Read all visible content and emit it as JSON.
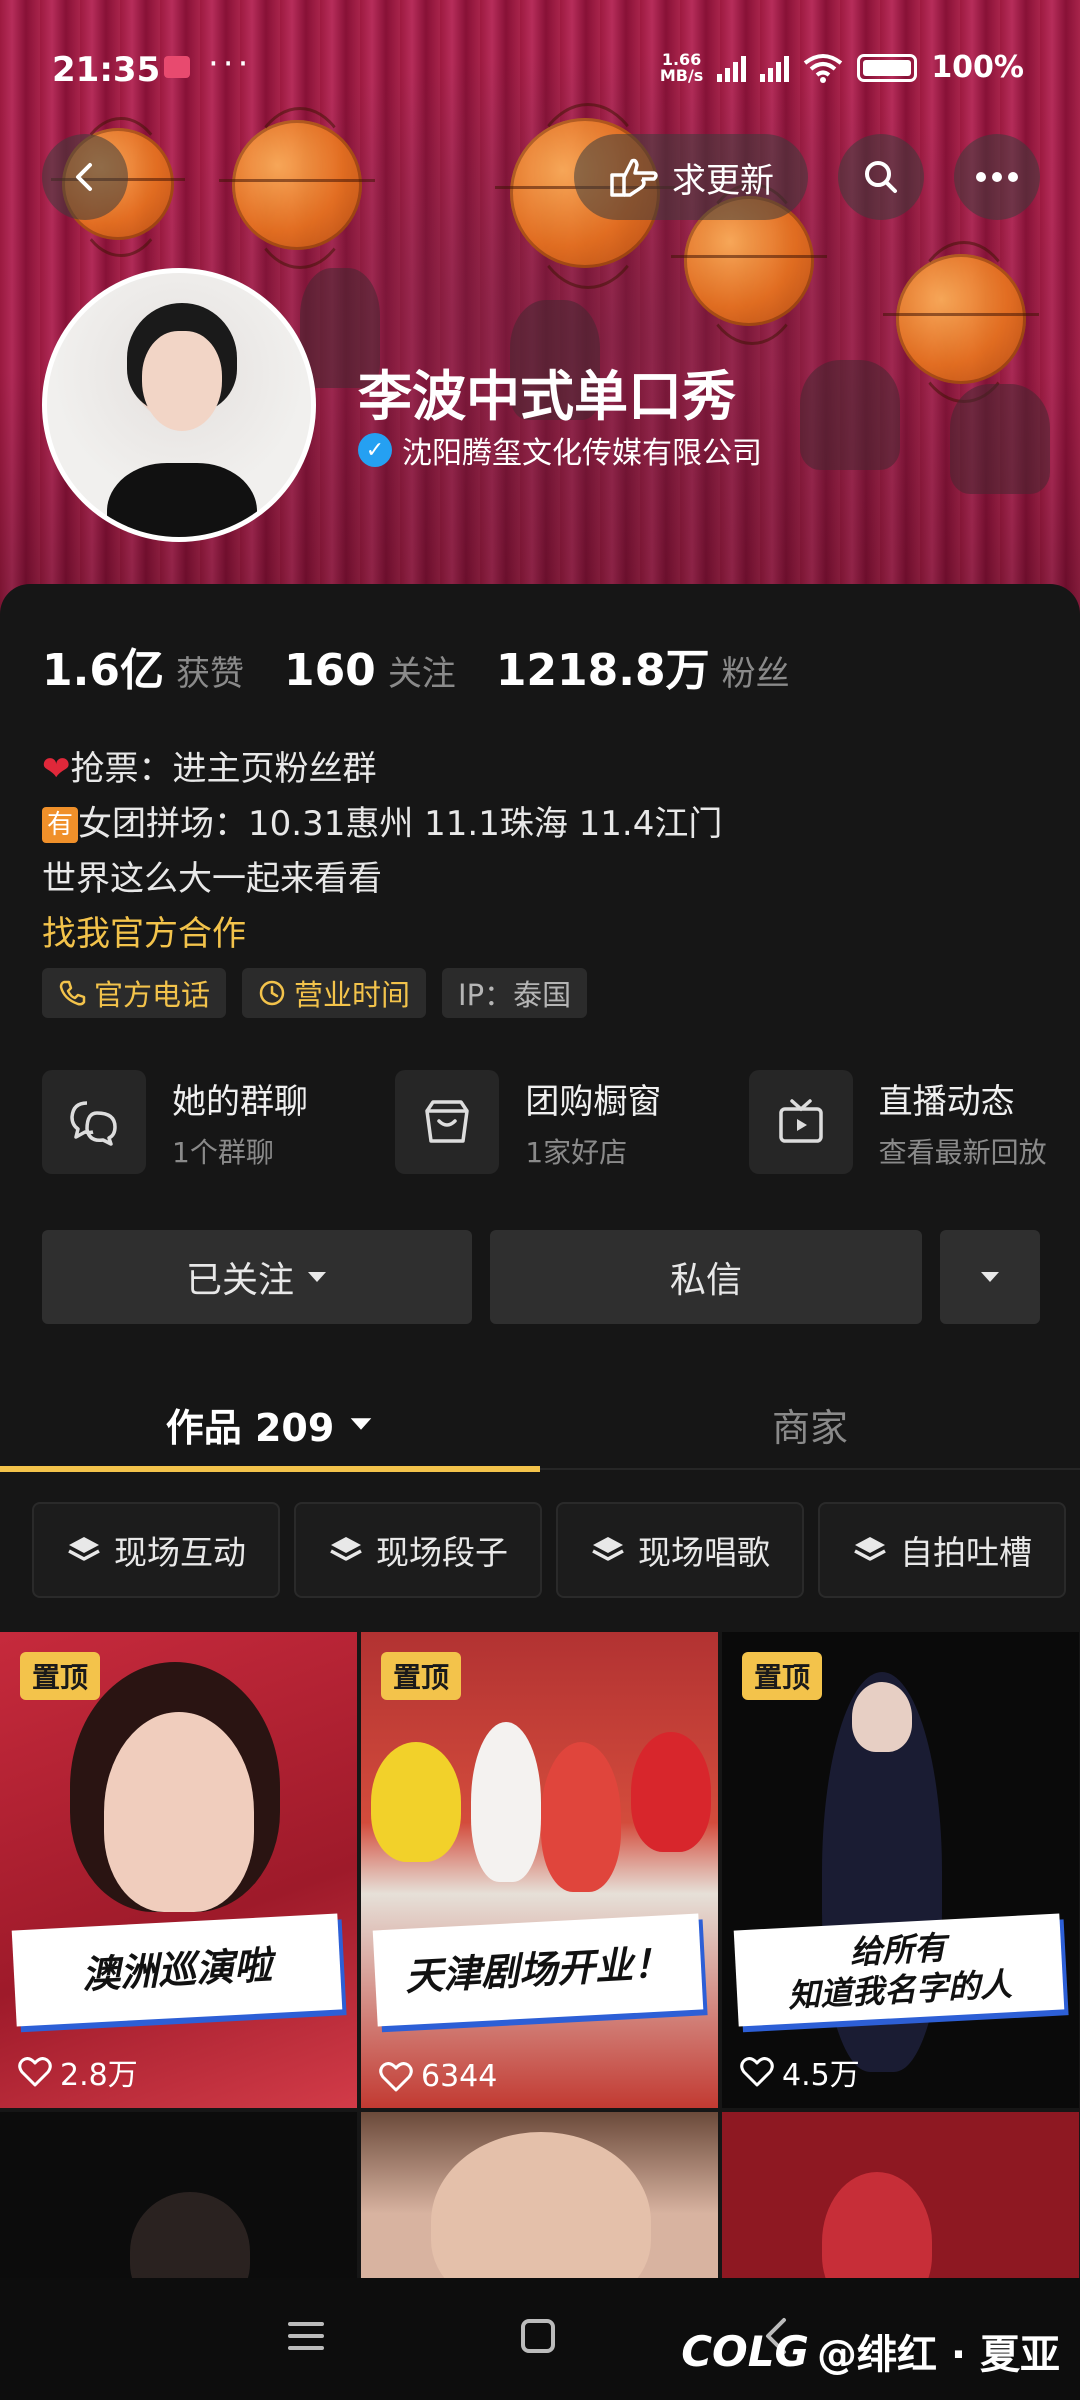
{
  "status_bar": {
    "time": "21:35",
    "more": "···",
    "speed_value": "1.66",
    "speed_unit": "MB/s",
    "battery": "100%"
  },
  "header": {
    "update_label": "求更新"
  },
  "profile": {
    "name": "李波中式单口秀",
    "verified_org": "沈阳腾玺文化传媒有限公司",
    "verify_mark": "✓"
  },
  "stats": [
    {
      "value": "1.6亿",
      "label": "获赞"
    },
    {
      "value": "160",
      "label": "关注"
    },
    {
      "value": "1218.8万",
      "label": "粉丝"
    }
  ],
  "bio": {
    "line1": "抢票：进主页粉丝群",
    "badge": "有",
    "line2": "女团拼场：10.31惠州 11.1珠海 11.4江门",
    "line3": "世界这么大一起来看看",
    "link": "找我官方合作"
  },
  "tags": {
    "phone": "官方电话",
    "hours": "营业时间",
    "ip": "IP：泰国"
  },
  "entries": [
    {
      "title": "她的群聊",
      "sub": "1个群聊",
      "icon": "chat-bubbles-icon"
    },
    {
      "title": "团购橱窗",
      "sub": "1家好店",
      "icon": "shop-basket-icon"
    },
    {
      "title": "直播动态",
      "sub": "查看最新回放",
      "icon": "tv-play-icon"
    }
  ],
  "actions": {
    "followed": "已关注",
    "message": "私信"
  },
  "tabs": {
    "works": "作品 209",
    "merchant": "商家"
  },
  "chips": [
    "现场互动",
    "现场段子",
    "现场唱歌",
    "自拍吐槽"
  ],
  "videos": [
    {
      "pinned": "置顶",
      "caption": "澳洲巡演啦",
      "likes": "2.8万"
    },
    {
      "pinned": "置顶",
      "caption": "天津剧场开业！",
      "likes": "6344"
    },
    {
      "pinned": "置顶",
      "caption": "给所有\n知道我名字的人",
      "likes": "4.5万"
    }
  ],
  "watermark": {
    "logo": "COLG",
    "text": "@绯红 · 夏亚"
  },
  "colors": {
    "accent_yellow": "#f3c34b",
    "verify_blue": "#25a0f2",
    "banner_red": "#c52a58"
  }
}
